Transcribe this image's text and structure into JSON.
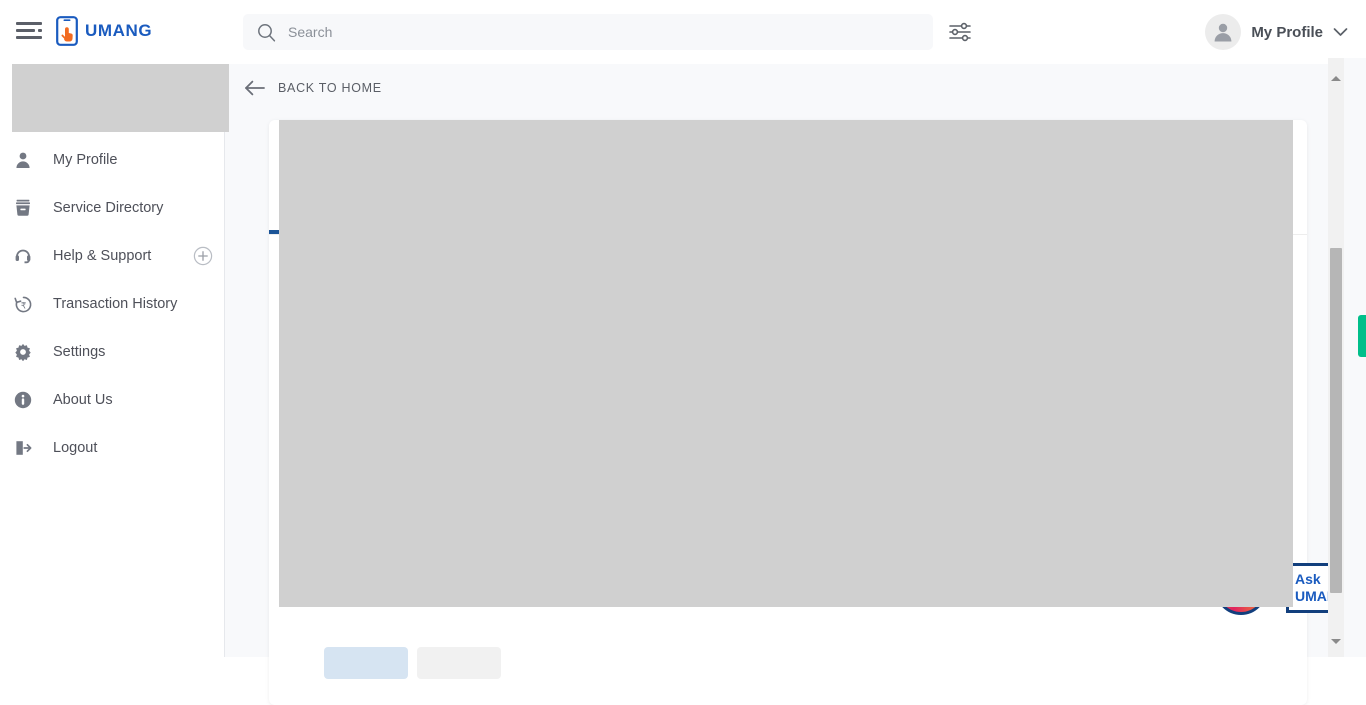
{
  "header": {
    "menu_icon": "hamburger-menu-icon",
    "brand": {
      "logo_icon": "umang-phone-hand-logo-icon",
      "name": "UMANG"
    },
    "search": {
      "icon": "search-icon",
      "placeholder": "Search",
      "value": ""
    },
    "filter_icon": "filter-sliders-icon",
    "profile": {
      "avatar_icon": "user-avatar-icon",
      "label": "My Profile",
      "chevron_icon": "chevron-down-icon"
    }
  },
  "sidebar": {
    "items": [
      {
        "label": "My Profile",
        "icon": "user-icon",
        "badge": ""
      },
      {
        "label": "Service Directory",
        "icon": "archive-box-icon",
        "badge": ""
      },
      {
        "label": "Help & Support",
        "icon": "headset-support-icon",
        "badge": "plus-circle-icon"
      },
      {
        "label": "Transaction History",
        "icon": "rupee-history-icon",
        "badge": ""
      },
      {
        "label": "Settings",
        "icon": "gear-icon",
        "badge": ""
      },
      {
        "label": "About Us",
        "icon": "info-circle-icon",
        "badge": ""
      },
      {
        "label": "Logout",
        "icon": "logout-arrow-icon",
        "badge": ""
      }
    ]
  },
  "content": {
    "back": {
      "icon": "arrow-left-icon",
      "label": "BACK TO HOME"
    },
    "kebab_icon": "more-vertical-icon"
  },
  "chat_widget": {
    "avatar_icon": "umang-bot-avatar-icon",
    "line1": "Ask",
    "line2": "UMANG"
  },
  "scrollbar": {
    "up_icon": "scroll-up-arrow-icon",
    "down_icon": "scroll-down-arrow-icon"
  },
  "side_tab": {
    "icon": "feedback-tab-icon",
    "color": "#00bf8a"
  },
  "colors": {
    "brand_blue": "#1a5bbf",
    "brand_orange": "#f26b21",
    "accent_green": "#00bf8a",
    "tab_underline": "#1b5497",
    "page_bg": "#f8f9fb",
    "placeholder_grey": "#d0d0d0"
  }
}
